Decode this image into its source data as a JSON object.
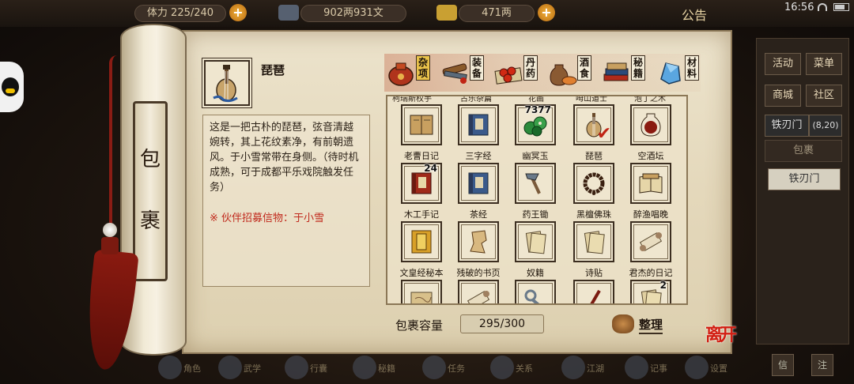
{
  "top": {
    "stamina": "体力 225/240",
    "money": "902两931文",
    "gold": "471两",
    "announce": "公告",
    "clock": "16:56"
  },
  "right_menu": {
    "activity": "活动",
    "menu": "菜单",
    "shop": "商城",
    "community": "社区",
    "location": "铁刃门",
    "coords": "(8,20)",
    "bag": "包裹",
    "sect": "铁刃门",
    "mini1": "信",
    "mini2": "注"
  },
  "scroll": {
    "char1": "包",
    "char2": "裹"
  },
  "selected": {
    "name": "琵琶",
    "description": "这是一把古朴的琵琶，弦音清越婉转，其上花纹素净，有前朝遗风。于小雪常带在身侧。（待时机成熟，可于成都平乐戏院触发任务）",
    "note": "※ 伙伴招募信物：于小雪"
  },
  "categories": [
    {
      "label": "杂项",
      "icon": "sack-icon",
      "active": true
    },
    {
      "label": "装备",
      "icon": "weapons-icon",
      "active": false
    },
    {
      "label": "丹药",
      "icon": "pills-icon",
      "active": false
    },
    {
      "label": "酒食",
      "icon": "wine-food-icon",
      "active": false
    },
    {
      "label": "秘籍",
      "icon": "books-icon",
      "active": false
    },
    {
      "label": "材料",
      "icon": "crystal-icon",
      "active": false
    }
  ],
  "cutoff_labels": [
    "柯瑞斯权手",
    "古乐杂篇",
    "花画",
    "呣山道士",
    "泡丁之木"
  ],
  "items": [
    {
      "name": "老曹日记",
      "icon": "old-book-icon",
      "count": "",
      "checked": false
    },
    {
      "name": "三字经",
      "icon": "blue-book-icon",
      "count": "",
      "checked": false
    },
    {
      "name": "幽冥玉",
      "icon": "jade-coins-icon",
      "count": "7377",
      "checked": false
    },
    {
      "name": "琵琶",
      "icon": "pipa-icon",
      "count": "",
      "checked": true
    },
    {
      "name": "空酒坛",
      "icon": "wine-jar-icon",
      "count": "",
      "checked": false
    },
    {
      "name": "木工手记",
      "icon": "red-book-icon",
      "count": "24",
      "checked": false
    },
    {
      "name": "茶经",
      "icon": "blue-book-icon",
      "count": "",
      "checked": false
    },
    {
      "name": "药王锄",
      "icon": "hoe-icon",
      "count": "",
      "checked": false
    },
    {
      "name": "黑檀佛珠",
      "icon": "prayer-beads-icon",
      "count": "",
      "checked": false
    },
    {
      "name": "醉渔唱晚",
      "icon": "open-book-icon",
      "count": "",
      "checked": false
    },
    {
      "name": "文皇经秘本",
      "icon": "yellow-book-icon",
      "count": "",
      "checked": false
    },
    {
      "name": "残破的书页",
      "icon": "torn-page-icon",
      "count": "",
      "checked": false
    },
    {
      "name": "奴籍",
      "icon": "paper-icon",
      "count": "",
      "checked": false
    },
    {
      "name": "诗贴",
      "icon": "paper-icon",
      "count": "",
      "checked": false
    },
    {
      "name": "君杰的日记",
      "icon": "scroll-icon",
      "count": "",
      "checked": false
    },
    {
      "name": "",
      "icon": "map-icon",
      "count": "",
      "checked": false
    },
    {
      "name": "",
      "icon": "scroll-icon",
      "count": "",
      "checked": false
    },
    {
      "name": "",
      "icon": "key-icon",
      "count": "",
      "checked": false
    },
    {
      "name": "",
      "icon": "brush-icon",
      "count": "",
      "checked": false
    },
    {
      "name": "",
      "icon": "paper-icon",
      "count": "2",
      "checked": false
    }
  ],
  "capacity": {
    "label": "包裹容量",
    "value": "295/300"
  },
  "sort_label": "整理",
  "leave_label": "离开",
  "bottom_bar": [
    "角色",
    "武学",
    "行囊",
    "秘籍",
    "任务",
    "关系",
    "江湖",
    "记事",
    "设置"
  ],
  "colors": {
    "paper": "#e4d8bb",
    "ink": "#1e140c",
    "accent_red": "#c0281c",
    "tab_active": "#e9c24a"
  }
}
